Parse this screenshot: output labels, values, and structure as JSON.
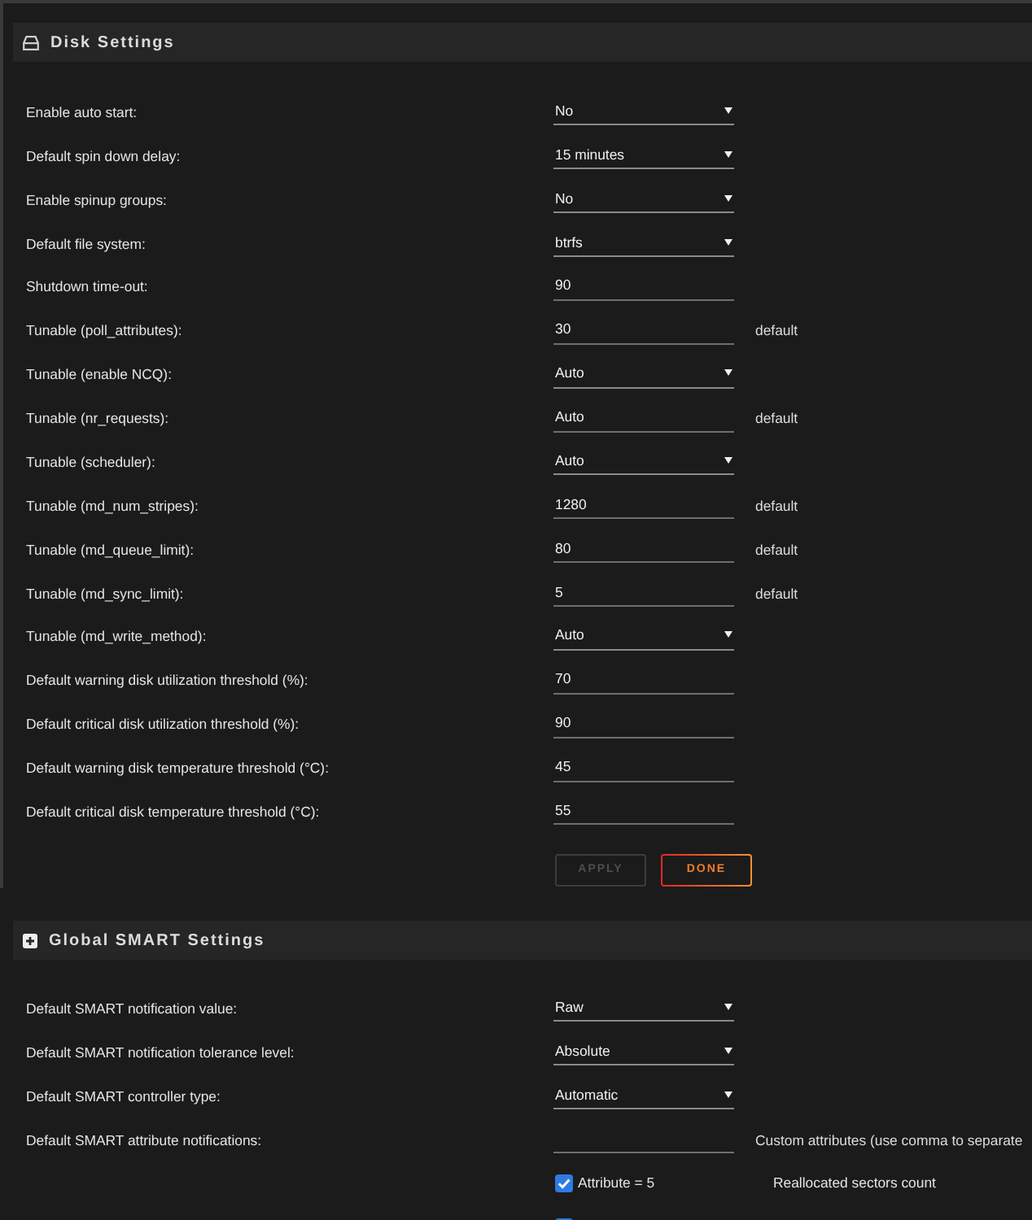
{
  "disk_settings": {
    "title": "Disk Settings",
    "rows": [
      {
        "label": "Enable auto start:",
        "kind": "select",
        "value": "No"
      },
      {
        "label": "Default spin down delay:",
        "kind": "select",
        "value": "15 minutes"
      },
      {
        "label": "Enable spinup groups:",
        "kind": "select",
        "value": "No"
      },
      {
        "label": "Default file system:",
        "kind": "select",
        "value": "btrfs"
      },
      {
        "label": "Shutdown time-out:",
        "kind": "input",
        "value": "90"
      },
      {
        "label": "Tunable (poll_attributes):",
        "kind": "input",
        "value": "30",
        "note": "default"
      },
      {
        "label": "Tunable (enable NCQ):",
        "kind": "select",
        "value": "Auto"
      },
      {
        "label": "Tunable (nr_requests):",
        "kind": "input",
        "value": "Auto",
        "note": "default"
      },
      {
        "label": "Tunable (scheduler):",
        "kind": "select",
        "value": "Auto"
      },
      {
        "label": "Tunable (md_num_stripes):",
        "kind": "input",
        "value": "1280",
        "note": "default"
      },
      {
        "label": "Tunable (md_queue_limit):",
        "kind": "input",
        "value": "80",
        "note": "default"
      },
      {
        "label": "Tunable (md_sync_limit):",
        "kind": "input",
        "value": "5",
        "note": "default"
      },
      {
        "label": "Tunable (md_write_method):",
        "kind": "select",
        "value": "Auto"
      },
      {
        "label": "Default warning disk utilization threshold (%):",
        "kind": "input",
        "value": "70"
      },
      {
        "label": "Default critical disk utilization threshold (%):",
        "kind": "input",
        "value": "90"
      },
      {
        "label": "Default warning disk temperature threshold (°C):",
        "kind": "input",
        "value": "45"
      },
      {
        "label": "Default critical disk temperature threshold (°C):",
        "kind": "input",
        "value": "55"
      }
    ],
    "buttons": [
      {
        "label": "APPLY",
        "disabled": true
      },
      {
        "label": "DONE",
        "disabled": false
      }
    ]
  },
  "global_smart_settings": {
    "title": "Global SMART Settings",
    "rows": [
      {
        "label": "Default SMART notification value:",
        "kind": "select",
        "value": "Raw"
      },
      {
        "label": "Default SMART notification tolerance level:",
        "kind": "select",
        "value": "Absolute"
      },
      {
        "label": "Default SMART controller type:",
        "kind": "select",
        "value": "Automatic"
      },
      {
        "label": "Default SMART attribute notifications:",
        "kind": "input",
        "note": "Custom attributes (use comma to separate"
      }
    ],
    "attributes": [
      {
        "label": "Attribute = 5",
        "description": "Reallocated sectors count",
        "checked": true
      },
      {
        "checked": true
      }
    ]
  }
}
